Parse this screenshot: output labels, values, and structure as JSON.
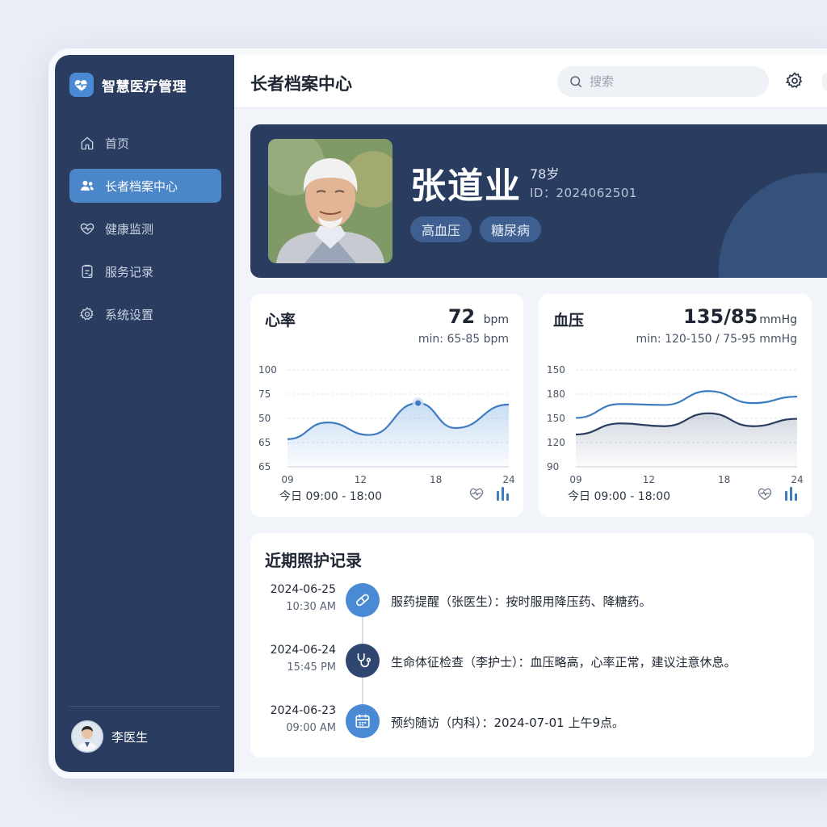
{
  "app": {
    "title": "智慧医疗管理"
  },
  "sidebar": {
    "items": [
      {
        "label": "首页",
        "icon": "home-icon"
      },
      {
        "label": "长者档案中心",
        "icon": "users-icon",
        "active": true
      },
      {
        "label": "健康监测",
        "icon": "heart-pulse-icon"
      },
      {
        "label": "服务记录",
        "icon": "clipboard-icon"
      },
      {
        "label": "系统设置",
        "icon": "gear-icon"
      }
    ],
    "user": {
      "name": "李医生"
    }
  },
  "header": {
    "title": "长者档案中心",
    "search_placeholder": "搜索"
  },
  "profile": {
    "name": "张道业",
    "age": "78岁",
    "id": "ID：2024062501",
    "tags": [
      "高血压",
      "糖尿病"
    ]
  },
  "metrics": {
    "heart": {
      "title": "心率",
      "value": "72",
      "unit": "bpm",
      "range": "min: 65-85 bpm",
      "footer": "今日 09:00 - 18:00"
    },
    "bp": {
      "title": "血压",
      "value": "135/85",
      "unit": "mmHg",
      "range": "min: 120-150 / 75-95 mmHg",
      "footer": "今日 09:00 - 18:00"
    }
  },
  "chart_data": [
    {
      "type": "area",
      "title": "心率",
      "x_ticks": [
        "09",
        "12",
        "18",
        "24"
      ],
      "y_ticks": [
        "100",
        "75",
        "50",
        "65",
        "65"
      ],
      "series": [
        {
          "values": [
            50,
            62,
            53,
            76,
            58,
            75
          ],
          "x": [
            0,
            0.18,
            0.37,
            0.59,
            0.76,
            1
          ]
        }
      ],
      "highlight_point": {
        "x": 0.59,
        "y": 76
      },
      "color": "#3d7cc0"
    },
    {
      "type": "line",
      "title": "血压",
      "x_ticks": [
        "09",
        "12",
        "18",
        "24"
      ],
      "y_ticks": [
        "150",
        "180",
        "150",
        "120",
        "90"
      ],
      "series": [
        {
          "values": [
            143,
            158,
            157,
            172,
            159,
            166
          ],
          "x": [
            0,
            0.2,
            0.4,
            0.6,
            0.8,
            1
          ],
          "color": "#3d7cc0"
        },
        {
          "values": [
            125,
            137,
            134,
            148,
            134,
            142
          ],
          "x": [
            0,
            0.2,
            0.4,
            0.6,
            0.8,
            1
          ],
          "color": "#2a3d60"
        }
      ]
    }
  ],
  "records": {
    "title": "近期照护记录",
    "items": [
      {
        "date": "2024-06-25",
        "time": "10:30 AM",
        "text": "服药提醒（张医生）：按时服用降压药、降糖药。",
        "icon": "pill-icon",
        "color": "#4a8ad4"
      },
      {
        "date": "2024-06-24",
        "time": "15:45 PM",
        "text": "生命体征检查（李护士）：血压略高，心率正常，建议注意休息。",
        "icon": "stethoscope-icon",
        "color": "#2f4670"
      },
      {
        "date": "2024-06-23",
        "time": "09:00 AM",
        "text": "预约随访（内科）：2024-07-01 上午9点。",
        "icon": "calendar-icon",
        "color": "#4a8ad4"
      }
    ]
  }
}
